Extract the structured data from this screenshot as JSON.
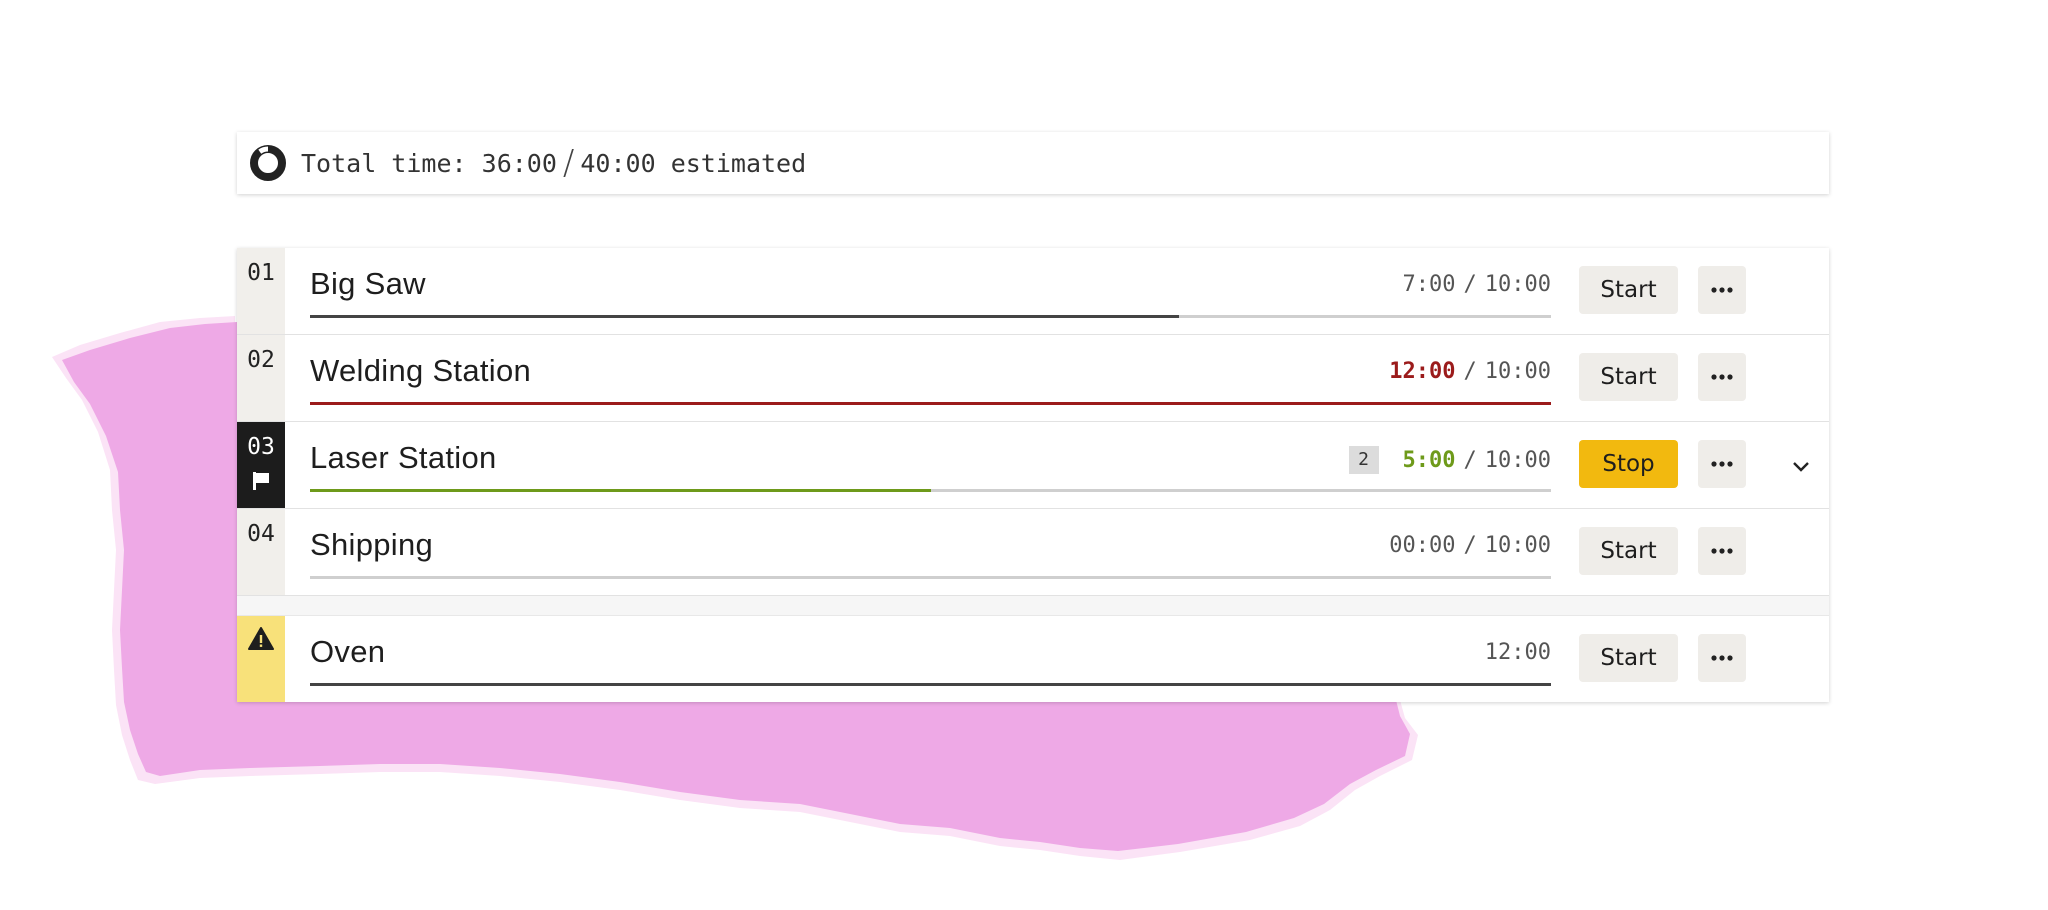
{
  "summary": {
    "label": "Total time:",
    "elapsed": "36:00",
    "estimate": "40:00",
    "suffix": "estimated",
    "progress": 0.9
  },
  "tasks": [
    {
      "index": "01",
      "name": "Big Saw",
      "current": "7:00",
      "separator": "/",
      "total": "10:00",
      "progress": 0.7,
      "button": "Start",
      "state": "normal"
    },
    {
      "index": "02",
      "name": "Welding Station",
      "current": "12:00",
      "separator": "/",
      "total": "10:00",
      "progress": 1.0,
      "button": "Start",
      "state": "over"
    },
    {
      "index": "03",
      "name": "Laser Station",
      "badge": "2",
      "current": "5:00",
      "separator": "/",
      "total": "10:00",
      "progress": 0.5,
      "button": "Stop",
      "state": "active"
    },
    {
      "index": "04",
      "name": "Shipping",
      "current": "00:00",
      "separator": "/",
      "total": "10:00",
      "progress": 0,
      "button": "Start",
      "state": "normal"
    }
  ],
  "unscheduled": {
    "name": "Oven",
    "current": "12:00",
    "progress": 1.0,
    "button": "Start",
    "state": "warning"
  },
  "icons": {
    "summary": "progress-donut-icon",
    "active": "flag-icon",
    "warning": "warning-triangle-icon",
    "more": "more-dots-icon",
    "expand": "chevron-down-icon"
  },
  "colors": {
    "overtime": "#9b1b1b",
    "on_track": "#6e9a1a",
    "stop_button": "#f2b90f",
    "warning": "#f8e17a",
    "paper": "#eea9e6"
  }
}
